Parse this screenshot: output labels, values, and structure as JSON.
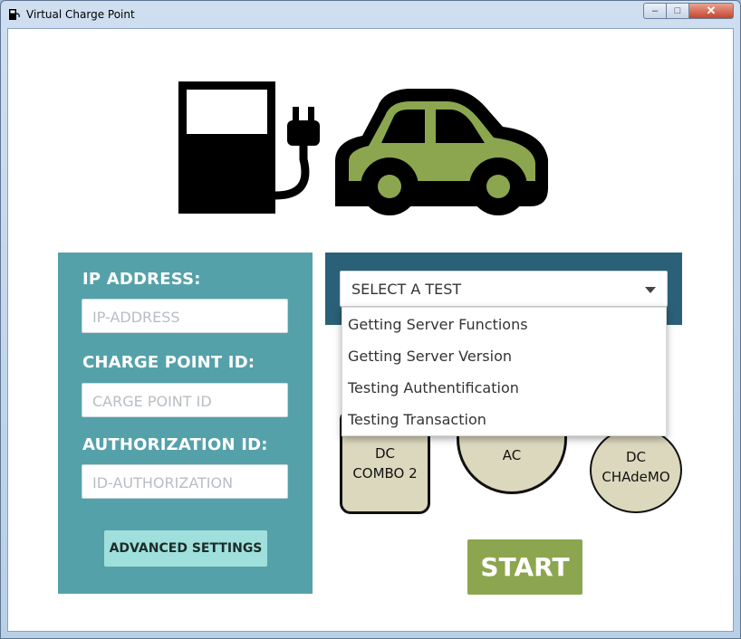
{
  "window": {
    "title": "Virtual Charge Point",
    "controls": {
      "minimize": "–",
      "maximize": "□",
      "close": "✕"
    }
  },
  "form": {
    "ip_label": "IP ADDRESS:",
    "ip_placeholder": "IP-ADDRESS",
    "cp_label": "CHARGE POINT ID:",
    "cp_placeholder": "CARGE POINT ID",
    "auth_label": "AUTHORIZATION ID:",
    "auth_placeholder": "ID-AUTHORIZATION",
    "advanced_button": "ADVANCED SETTINGS"
  },
  "test_select": {
    "value": "SELECT A TEST",
    "options": [
      "Getting Server Functions",
      "Getting Server Version",
      "Testing Authentification",
      "Testing Transaction"
    ]
  },
  "connectors": {
    "combo": [
      "DC",
      "COMBO 2"
    ],
    "ac": "AC",
    "chademo": [
      "DC",
      "CHAdeMO"
    ]
  },
  "start_button": "START",
  "colors": {
    "left_panel": "#55a1aa",
    "top_bar": "#2a6178",
    "advanced_button": "#9fe0dc",
    "start_button": "#8ca64f",
    "car": "#8ca64f",
    "connector_fill": "#dcd8bd"
  }
}
